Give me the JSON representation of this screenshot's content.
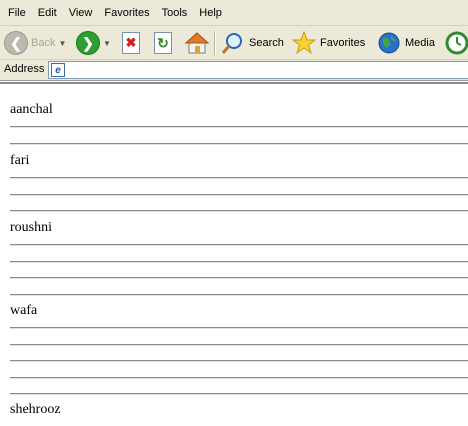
{
  "menu": [
    "File",
    "Edit",
    "View",
    "Favorites",
    "Tools",
    "Help"
  ],
  "toolbar": {
    "back_label": "Back",
    "search_label": "Search",
    "favorites_label": "Favorites",
    "media_label": "Media"
  },
  "address": {
    "label": "Address",
    "value": ""
  },
  "entries": [
    {
      "name": "aanchal",
      "lines": 2
    },
    {
      "name": "fari",
      "lines": 3
    },
    {
      "name": "roushni",
      "lines": 4
    },
    {
      "name": "wafa",
      "lines": 5
    },
    {
      "name": "shehrooz",
      "lines": 0
    }
  ],
  "colors": {
    "chrome": "#ece9d8",
    "rule": "#8a8a8a"
  }
}
